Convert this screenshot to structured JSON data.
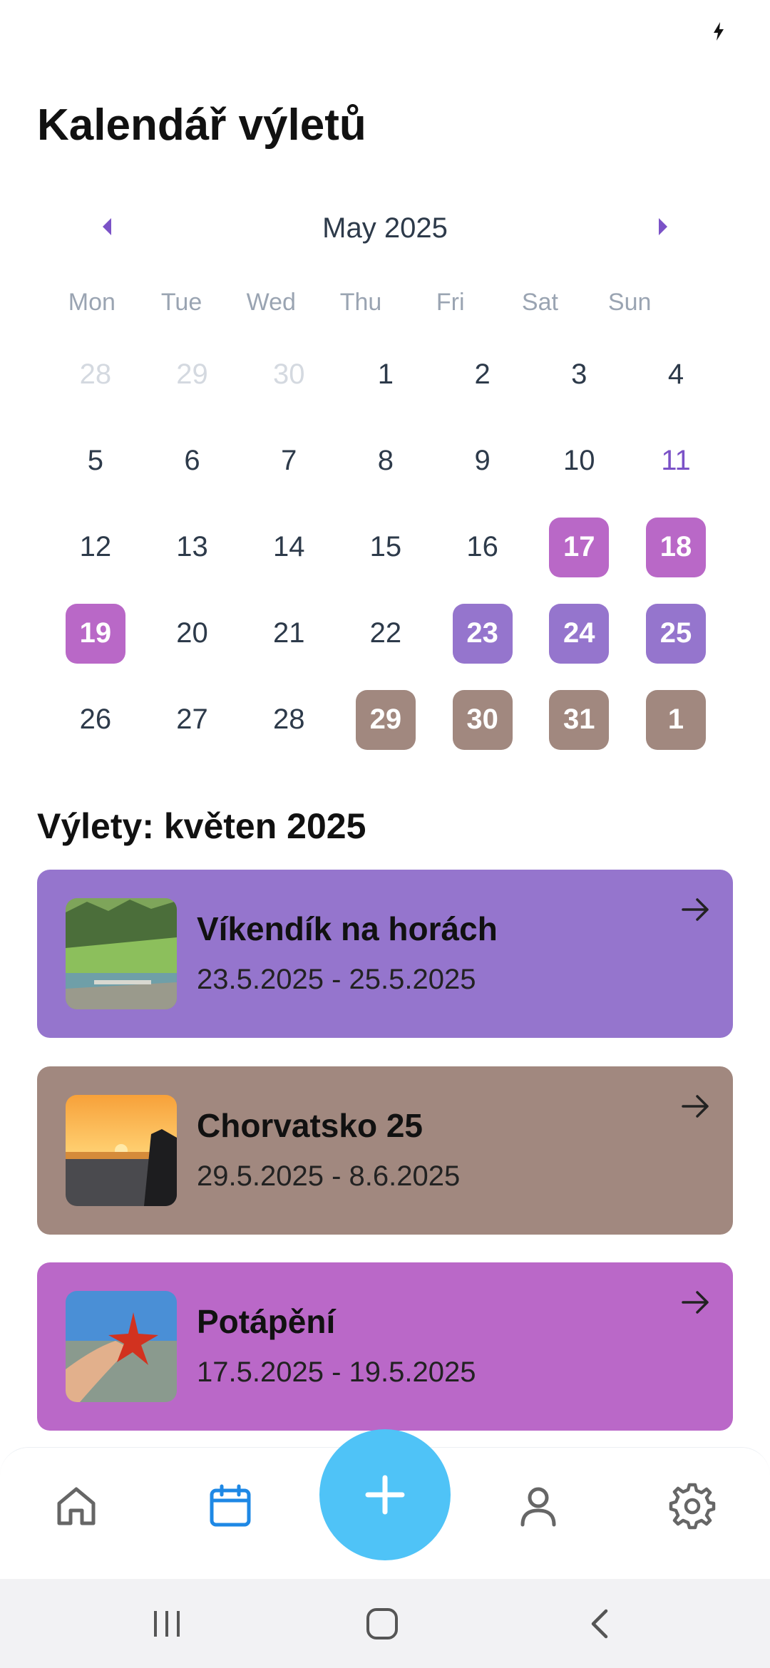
{
  "status_bar": {
    "icons": [
      "battery-charging-icon"
    ]
  },
  "title": "Kalendář výletů",
  "calendar": {
    "month_label": "May 2025",
    "weekdays": [
      "Mon",
      "Tue",
      "Wed",
      "Thu",
      "Fri",
      "Sat",
      "Sun"
    ],
    "weeks": [
      [
        {
          "d": "28",
          "s": "muted"
        },
        {
          "d": "29",
          "s": "muted"
        },
        {
          "d": "30",
          "s": "muted"
        },
        {
          "d": "1"
        },
        {
          "d": "2"
        },
        {
          "d": "3"
        },
        {
          "d": "4"
        }
      ],
      [
        {
          "d": "5"
        },
        {
          "d": "6"
        },
        {
          "d": "7"
        },
        {
          "d": "8"
        },
        {
          "d": "9"
        },
        {
          "d": "10"
        },
        {
          "d": "11",
          "s": "today"
        }
      ],
      [
        {
          "d": "12"
        },
        {
          "d": "13"
        },
        {
          "d": "14"
        },
        {
          "d": "15"
        },
        {
          "d": "16"
        },
        {
          "d": "17",
          "s": "hl",
          "c": "#b968c7"
        },
        {
          "d": "18",
          "s": "hl",
          "c": "#b968c7"
        }
      ],
      [
        {
          "d": "19",
          "s": "hl",
          "c": "#b968c7"
        },
        {
          "d": "20"
        },
        {
          "d": "21"
        },
        {
          "d": "22"
        },
        {
          "d": "23",
          "s": "hl",
          "c": "#9575cd"
        },
        {
          "d": "24",
          "s": "hl",
          "c": "#9575cd"
        },
        {
          "d": "25",
          "s": "hl",
          "c": "#9575cd"
        }
      ],
      [
        {
          "d": "26"
        },
        {
          "d": "27"
        },
        {
          "d": "28"
        },
        {
          "d": "29",
          "s": "hl",
          "c": "#a1887f"
        },
        {
          "d": "30",
          "s": "hl",
          "c": "#a1887f"
        },
        {
          "d": "31",
          "s": "hl",
          "c": "#a1887f"
        },
        {
          "d": "1",
          "s": "hl",
          "c": "#a1887f"
        }
      ]
    ],
    "accent": "#7b52c7"
  },
  "section_title": "Výlety: květen 2025",
  "trips": [
    {
      "name": "Víkendík na horách",
      "dates": "23.5.2025 - 25.5.2025",
      "color": "#9575cd",
      "image": "mountain-lake-photo"
    },
    {
      "name": "Chorvatsko 25",
      "dates": "29.5.2025 - 8.6.2025",
      "color": "#a1887f",
      "image": "sunset-sea-photo"
    },
    {
      "name": "Potápění",
      "dates": "17.5.2025 - 19.5.2025",
      "color": "#ba68c8",
      "image": "starfish-hand-photo"
    }
  ],
  "bottom_nav": {
    "items": [
      "home-icon",
      "calendar-icon",
      "add-icon",
      "profile-icon",
      "settings-icon"
    ],
    "active": "calendar-icon",
    "active_color": "#1e88e5",
    "fab_color": "#4fc3f7"
  },
  "system_nav": [
    "recents-icon",
    "home-icon",
    "back-icon"
  ]
}
